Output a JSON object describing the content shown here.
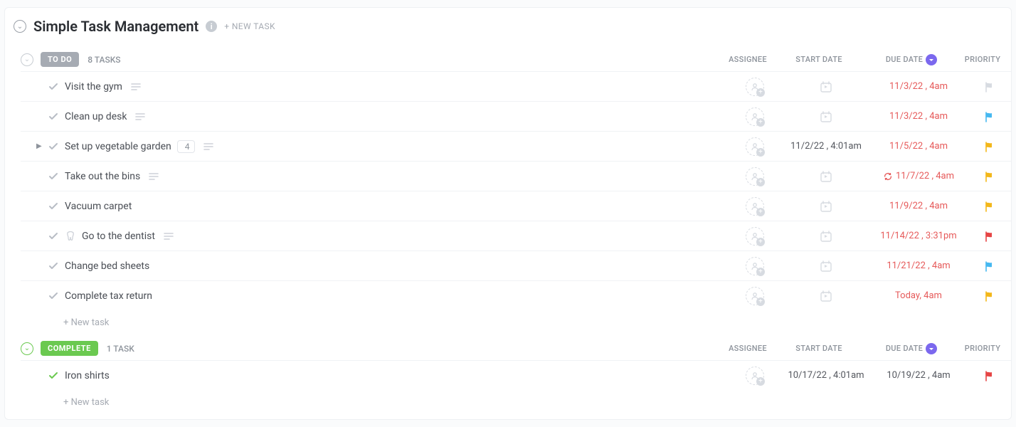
{
  "header": {
    "title": "Simple Task Management",
    "new_task_label": "+ NEW TASK"
  },
  "columns": {
    "assignee": "ASSIGNEE",
    "start": "START DATE",
    "due": "DUE DATE",
    "priority": "PRIORITY"
  },
  "groups": [
    {
      "status_label": "TO DO",
      "status_class": "todo",
      "collapse_class": "",
      "count_label": "8 TASKS",
      "new_task_label": "+ New task",
      "tasks": [
        {
          "title": "Visit the gym",
          "done": false,
          "has_desc": true,
          "expand": false,
          "subtasks": null,
          "tooth": false,
          "start": "",
          "due": "11/3/22 , 4am",
          "due_neutral": false,
          "recurring": false,
          "flag": "none"
        },
        {
          "title": "Clean up desk",
          "done": false,
          "has_desc": true,
          "expand": false,
          "subtasks": null,
          "tooth": false,
          "start": "",
          "due": "11/3/22 , 4am",
          "due_neutral": false,
          "recurring": false,
          "flag": "blue"
        },
        {
          "title": "Set up vegetable garden",
          "done": false,
          "has_desc": true,
          "expand": true,
          "subtasks": "4",
          "tooth": false,
          "start": "11/2/22 , 4:01am",
          "due": "11/5/22 , 4am",
          "due_neutral": false,
          "recurring": false,
          "flag": "yellow"
        },
        {
          "title": "Take out the bins",
          "done": false,
          "has_desc": true,
          "expand": false,
          "subtasks": null,
          "tooth": false,
          "start": "",
          "due": "11/7/22 , 4am",
          "due_neutral": false,
          "recurring": true,
          "flag": "yellow"
        },
        {
          "title": "Vacuum carpet",
          "done": false,
          "has_desc": false,
          "expand": false,
          "subtasks": null,
          "tooth": false,
          "start": "",
          "due": "11/9/22 , 4am",
          "due_neutral": false,
          "recurring": false,
          "flag": "yellow"
        },
        {
          "title": "Go to the dentist",
          "done": false,
          "has_desc": true,
          "expand": false,
          "subtasks": null,
          "tooth": true,
          "start": "",
          "due": "11/14/22 , 3:31pm",
          "due_neutral": false,
          "recurring": false,
          "flag": "red"
        },
        {
          "title": "Change bed sheets",
          "done": false,
          "has_desc": false,
          "expand": false,
          "subtasks": null,
          "tooth": false,
          "start": "",
          "due": "11/21/22 , 4am",
          "due_neutral": false,
          "recurring": false,
          "flag": "blue"
        },
        {
          "title": "Complete tax return",
          "done": false,
          "has_desc": false,
          "expand": false,
          "subtasks": null,
          "tooth": false,
          "start": "",
          "due": "Today, 4am",
          "due_neutral": false,
          "recurring": false,
          "flag": "yellow"
        }
      ]
    },
    {
      "status_label": "COMPLETE",
      "status_class": "complete",
      "collapse_class": "green",
      "count_label": "1 TASK",
      "new_task_label": "+ New task",
      "tasks": [
        {
          "title": "Iron shirts",
          "done": true,
          "has_desc": false,
          "expand": false,
          "subtasks": null,
          "tooth": false,
          "start": "10/17/22 , 4:01am",
          "due": "10/19/22 , 4am",
          "due_neutral": true,
          "recurring": false,
          "flag": "red"
        }
      ]
    }
  ]
}
